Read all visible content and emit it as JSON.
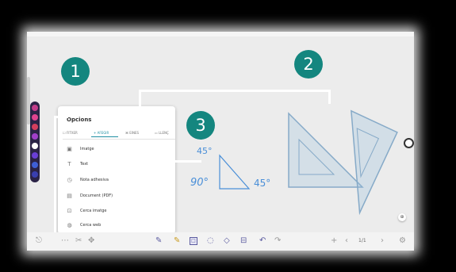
{
  "panel": {
    "title": "Opcions",
    "tabs": [
      {
        "label": "FITXER"
      },
      {
        "label": "AFEGIR"
      },
      {
        "label": "EINES"
      },
      {
        "label": "LLENÇ"
      }
    ],
    "items": [
      {
        "label": "Imatge"
      },
      {
        "label": "Text"
      },
      {
        "label": "Nota adhesiva"
      },
      {
        "label": "Document (PDF)"
      },
      {
        "label": "Cerca imatge"
      },
      {
        "label": "Cerca web"
      }
    ]
  },
  "badges": {
    "one": "1",
    "two": "2",
    "three": "3"
  },
  "canvas": {
    "angle_top": "45°",
    "angle_left": "90°",
    "angle_right": "45°"
  },
  "toolbar": {
    "page_indicator": "1/1",
    "icons": [
      "exit-icon",
      "more-icon",
      "tools-icon",
      "move-icon",
      "pen-icon",
      "highlighter-icon",
      "shape-icon",
      "lasso-icon",
      "eraser-icon",
      "clear-icon",
      "undo-icon",
      "redo-icon",
      "add-page-icon",
      "prev-page-icon",
      "next-page-icon",
      "settings-icon"
    ]
  },
  "colors": {
    "badge": "#14867f",
    "accent": "#1f8fa3",
    "ink": "#4a8fd8",
    "palette_bg": "#2b2346"
  }
}
